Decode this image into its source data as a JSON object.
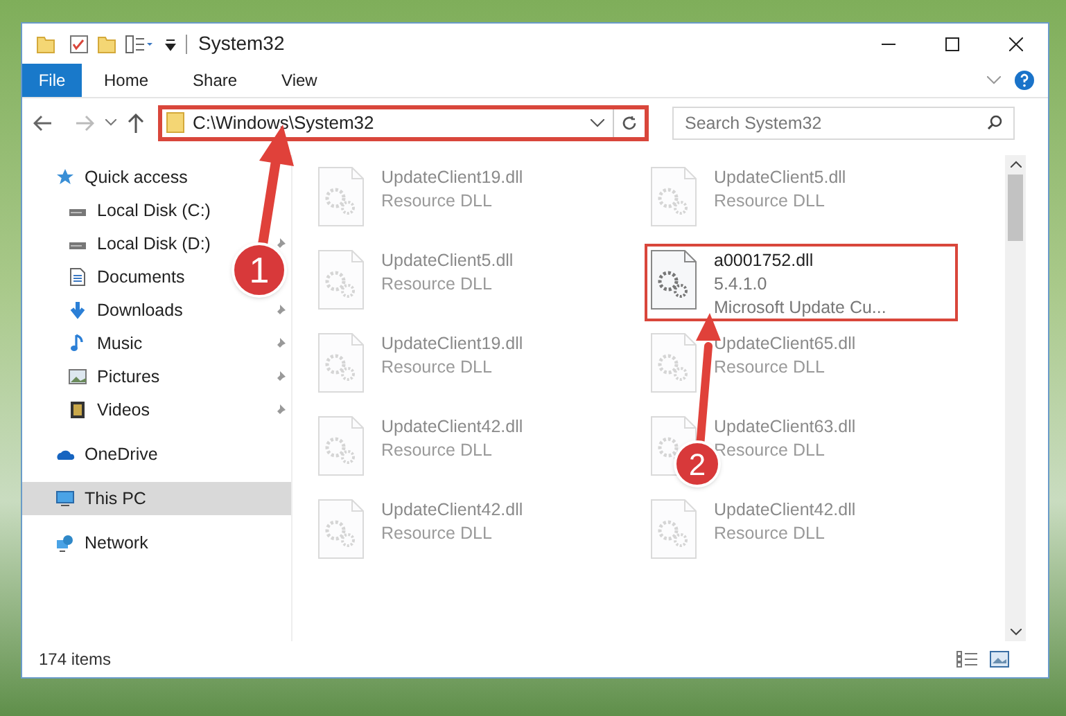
{
  "window": {
    "title": "System32"
  },
  "ribbon_tabs": [
    {
      "label": "File",
      "kind": "file"
    },
    {
      "label": "Home",
      "kind": "tab"
    },
    {
      "label": "Share",
      "kind": "tab"
    },
    {
      "label": "View",
      "kind": "tab"
    }
  ],
  "address_bar": {
    "path": "C:\\Windows\\System32",
    "highlighted": true
  },
  "search": {
    "placeholder": "Search System32"
  },
  "sidebar": {
    "items": [
      {
        "label": "Quick access",
        "kind": "star",
        "selected": false,
        "children": [
          {
            "label": "Local Disk (C:)",
            "kind": "drive",
            "pinned": false,
            "selected": false
          },
          {
            "label": "Local Disk (D:)",
            "kind": "drive",
            "pinned": true,
            "selected": false
          },
          {
            "label": "Documents",
            "kind": "document",
            "selected": false
          },
          {
            "label": "Downloads",
            "kind": "download",
            "pinned": true,
            "selected": false
          },
          {
            "label": "Music",
            "kind": "music",
            "pinned": true,
            "selected": false
          },
          {
            "label": "Pictures",
            "kind": "picture",
            "pinned": true,
            "selected": false
          },
          {
            "label": "Videos",
            "kind": "video",
            "pinned": true,
            "selected": false
          }
        ]
      },
      {
        "label": "OneDrive",
        "kind": "cloud",
        "selected": false
      },
      {
        "label": "This PC",
        "kind": "monitor",
        "selected": true
      },
      {
        "label": "Network",
        "kind": "network",
        "selected": false
      }
    ]
  },
  "files": [
    {
      "name": "UpdateClient19.dll",
      "lines": [
        "Resource DLL"
      ],
      "dimmed": true,
      "highlighted": false
    },
    {
      "name": "UpdateClient5.dll",
      "lines": [
        "Resource DLL"
      ],
      "dimmed": true,
      "highlighted": false
    },
    {
      "name": "UpdateClient5.dll",
      "lines": [
        "Resource DLL"
      ],
      "dimmed": true,
      "highlighted": false
    },
    {
      "name": "a0001752.dll",
      "lines": [
        "5.4.1.0",
        "Microsoft Update Cu..."
      ],
      "dimmed": false,
      "highlighted": true
    },
    {
      "name": "UpdateClient19.dll",
      "lines": [
        "Resource DLL"
      ],
      "dimmed": true,
      "highlighted": false
    },
    {
      "name": "UpdateClient65.dll",
      "lines": [
        "Resource DLL"
      ],
      "dimmed": true,
      "highlighted": false
    },
    {
      "name": "UpdateClient42.dll",
      "lines": [
        "Resource DLL"
      ],
      "dimmed": true,
      "highlighted": false
    },
    {
      "name": "UpdateClient63.dll",
      "lines": [
        "Resource DLL"
      ],
      "dimmed": true,
      "highlighted": false
    },
    {
      "name": "UpdateClient42.dll",
      "lines": [
        "Resource DLL"
      ],
      "dimmed": true,
      "highlighted": false
    },
    {
      "name": "UpdateClient42.dll",
      "lines": [
        "Resource DLL"
      ],
      "dimmed": true,
      "highlighted": false
    }
  ],
  "status_bar": {
    "item_count": "174 items"
  },
  "callouts": [
    {
      "label": "1"
    },
    {
      "label": "2"
    }
  ]
}
